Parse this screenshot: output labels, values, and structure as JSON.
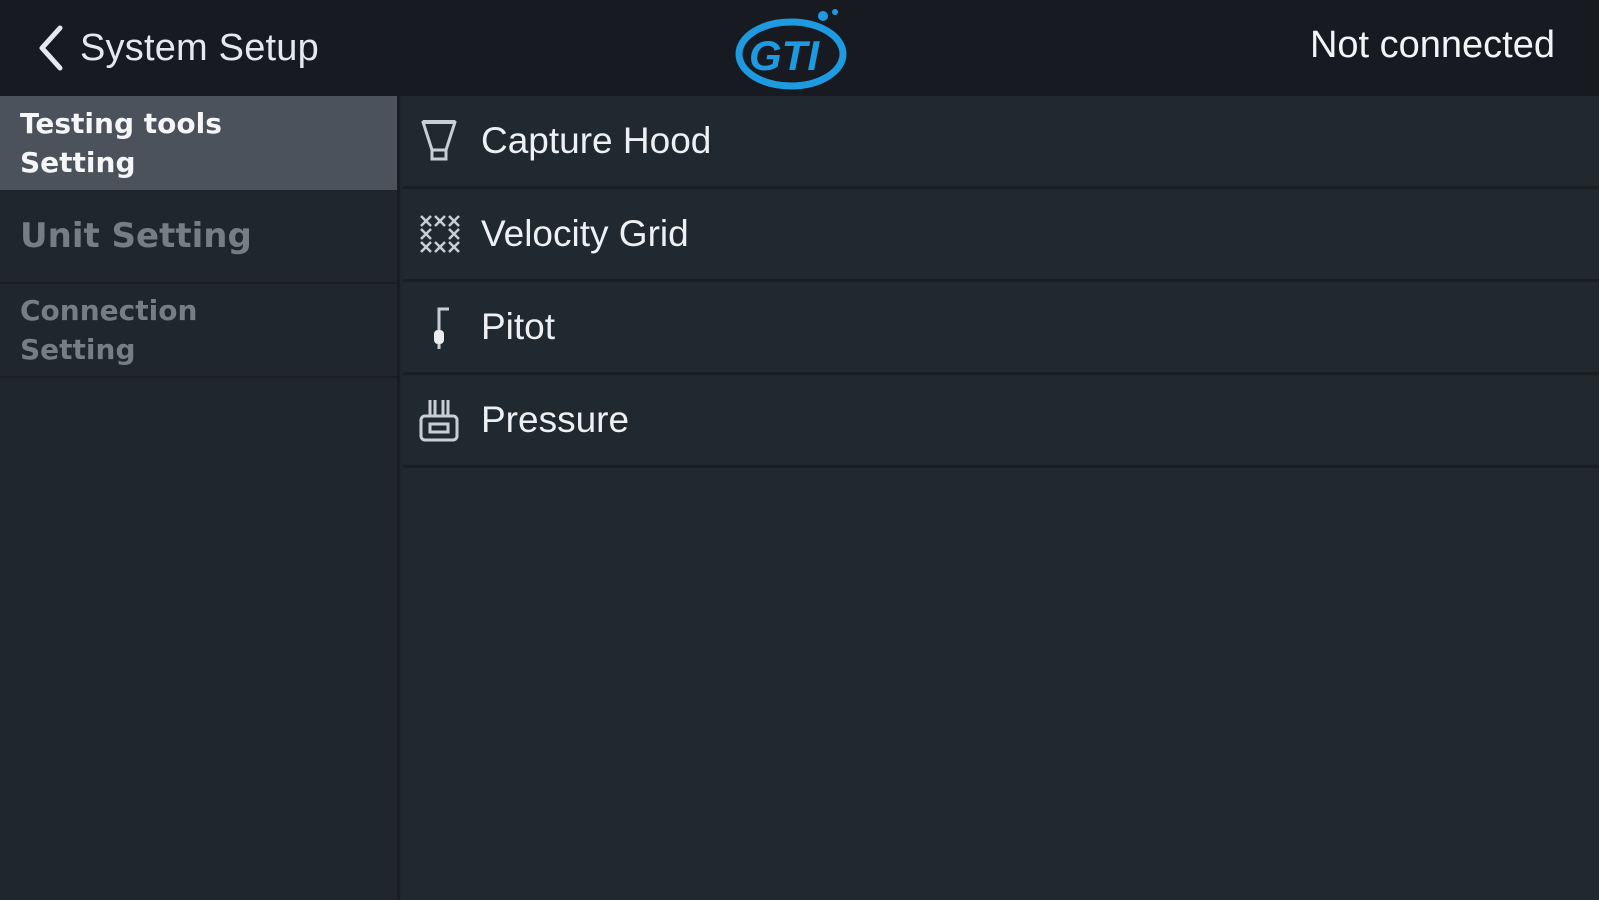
{
  "header": {
    "back_label": "System Setup",
    "logo_text": "GTI",
    "status": "Not connected"
  },
  "sidebar": {
    "items": [
      {
        "label": "Testing tools Setting",
        "active": true
      },
      {
        "label": "Unit Setting",
        "active": false
      },
      {
        "label": "Connection Setting",
        "active": false
      }
    ]
  },
  "tools": {
    "items": [
      {
        "label": "Capture Hood",
        "icon": "capture-hood-icon"
      },
      {
        "label": "Velocity Grid",
        "icon": "velocity-grid-icon"
      },
      {
        "label": "Pitot",
        "icon": "pitot-icon"
      },
      {
        "label": "Pressure",
        "icon": "pressure-icon"
      }
    ]
  },
  "colors": {
    "logo_blue": "#1e9be0",
    "active_bg": "#4b525b"
  }
}
